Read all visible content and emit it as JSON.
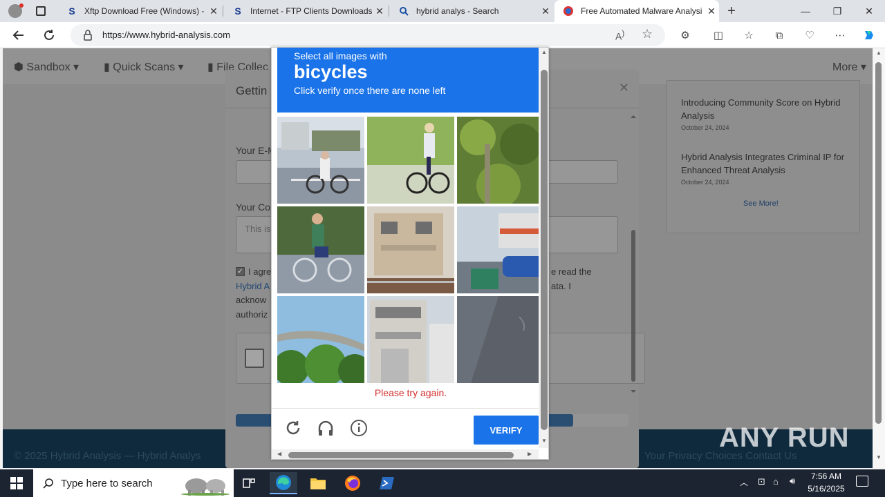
{
  "browser": {
    "tabs": [
      {
        "title": "Xftp Download Free (Windows) -",
        "favicon": "S"
      },
      {
        "title": "Internet - FTP Clients Downloads",
        "favicon": "S"
      },
      {
        "title": "hybrid analys - Search",
        "favicon": "search-icon"
      },
      {
        "title": "Free Automated Malware Analysi",
        "favicon": "hybrid-analysis-icon",
        "active": true
      }
    ],
    "url": "https://www.hybrid-analysis.com",
    "window_buttons": [
      "—",
      "❐",
      "✕"
    ]
  },
  "site": {
    "nav": [
      "Sandbox",
      "Quick Scans",
      "File Collec",
      "More"
    ],
    "news": [
      {
        "title": "Introducing Community Score on Hybrid Analysis",
        "date": "October 24, 2024"
      },
      {
        "title": "Hybrid Analysis Integrates Criminal IP for Enhanced Threat Analysis",
        "date": "October 24, 2024"
      }
    ],
    "see_more": "See More!",
    "footer_left": "© 2025 Hybrid Analysis — Hybrid Analys",
    "footer_right": "Your Privacy Choices     Contact Us"
  },
  "modal": {
    "title": "Gettin",
    "email_label": "Your E-M",
    "comment_label": "Your Co",
    "comment_placeholder": "This is",
    "agree_lines": [
      "I agre",
      "Hybrid A",
      "acknow",
      "authoriz"
    ],
    "agree_right_lines": [
      "e read the",
      "ata. I"
    ],
    "progress_fraction": 0.86
  },
  "captcha": {
    "instruction": "Select all images with",
    "object": "bicycles",
    "hint": "Click verify once there are none left",
    "error": "Please try again.",
    "verify_label": "VERIFY",
    "tiles": [
      "bicycle-street",
      "bicycle-rider-grass",
      "bushes",
      "bicycle-girl",
      "house-rail",
      "city-street-car",
      "overpass-trees",
      "house-building",
      "asphalt"
    ]
  },
  "taskbar": {
    "search_placeholder": "Type here to search",
    "time": "7:56 AM",
    "date": "5/16/2025"
  },
  "watermark": "ANY RUN",
  "colors": {
    "captcha_blue": "#1a73e8",
    "error_red": "#d32f2f",
    "footer_navy": "#0f2a3c"
  }
}
